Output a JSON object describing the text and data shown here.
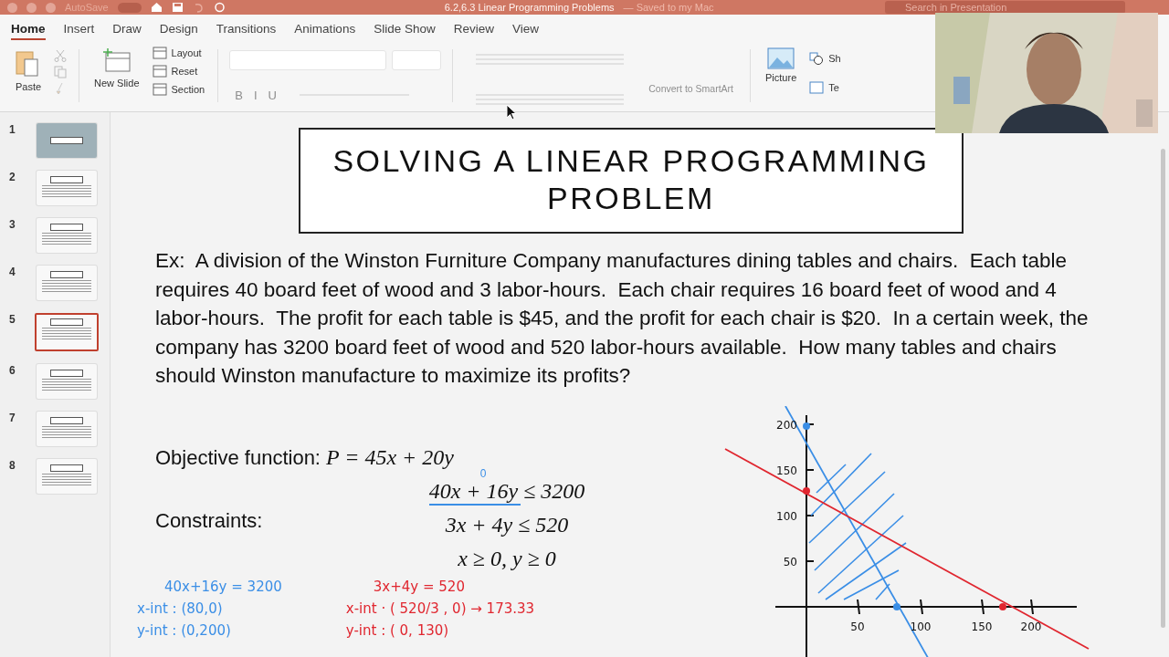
{
  "title_bar": {
    "autosave": "AutoSave",
    "autosave_on": false,
    "title": "6.2,6.3 Linear Programming Problems",
    "saved_note": "— Saved to my Mac",
    "search": {
      "placeholder": "Search in Presentation"
    }
  },
  "tabs": [
    {
      "label": "Home",
      "selected": true
    },
    {
      "label": "Insert",
      "selected": false
    },
    {
      "label": "Draw",
      "selected": false
    },
    {
      "label": "Design",
      "selected": false
    },
    {
      "label": "Transitions",
      "selected": false
    },
    {
      "label": "Animations",
      "selected": false
    },
    {
      "label": "Slide Show",
      "selected": false
    },
    {
      "label": "Review",
      "selected": false
    },
    {
      "label": "View",
      "selected": false
    }
  ],
  "ribbon": {
    "paste": "Paste",
    "new_slide": "New Slide",
    "slide_buttons": [
      "Layout",
      "Reset",
      "Section"
    ],
    "format_buttons": [
      {
        "label": "B",
        "disabled": true
      },
      {
        "label": "I",
        "disabled": true
      },
      {
        "label": "U",
        "disabled": true
      }
    ],
    "convert": {
      "label": "Convert to SmartArt",
      "disabled": true
    },
    "picture": "Picture",
    "shapes": "Sh",
    "text_box": "Te"
  },
  "slides": [
    {
      "number": "1",
      "kind": "title",
      "selected": false
    },
    {
      "number": "2",
      "kind": "content",
      "selected": false
    },
    {
      "number": "3",
      "kind": "content",
      "selected": false
    },
    {
      "number": "4",
      "kind": "content",
      "selected": false
    },
    {
      "number": "5",
      "kind": "content",
      "selected": true
    },
    {
      "number": "6",
      "kind": "content",
      "selected": false
    },
    {
      "number": "7",
      "kind": "content",
      "selected": false
    },
    {
      "number": "8",
      "kind": "content",
      "selected": false
    }
  ],
  "slide": {
    "title": "SOLVING A LINEAR PROGRAMMING PROBLEM",
    "problem": "Ex:  A division of the Winston Furniture Company manufactures dining tables and chairs.  Each table requires 40 board feet of wood and 3 labor-hours.  Each chair requires 16 board feet of wood and 4 labor-hours.  The profit for each table is $45, and the profit for each chair is $20.  In a certain week, the company has 3200 board feet of wood and 520 labor-hours available.  How many tables and chairs should Winston manufacture to maximize its profits?",
    "objective": {
      "label": "Objective function:",
      "formula": "P = 45x + 20y"
    },
    "constraints": {
      "label": "Constraints:",
      "items": [
        "40x + 16y ≤ 3200",
        "3x + 4y ≤ 520",
        "x ≥ 0, y ≥ 0"
      ]
    },
    "annotation": "0",
    "notes": [
      {
        "color": "#3a8ee6",
        "lines": [
          "40x+16y = 3200",
          "x-int : (80,0)",
          "y-int : (0,200)"
        ]
      },
      {
        "color": "#e0262f",
        "lines": [
          "3x+4y = 520",
          "x-int · ( 520/3 , 0) → 173.33",
          "y-int : ( 0, 130)"
        ]
      }
    ],
    "graph": {
      "y_ticks": [
        "200",
        "150",
        "100",
        "50"
      ],
      "x_ticks": [
        "50",
        "100",
        "150",
        "200"
      ]
    }
  }
}
